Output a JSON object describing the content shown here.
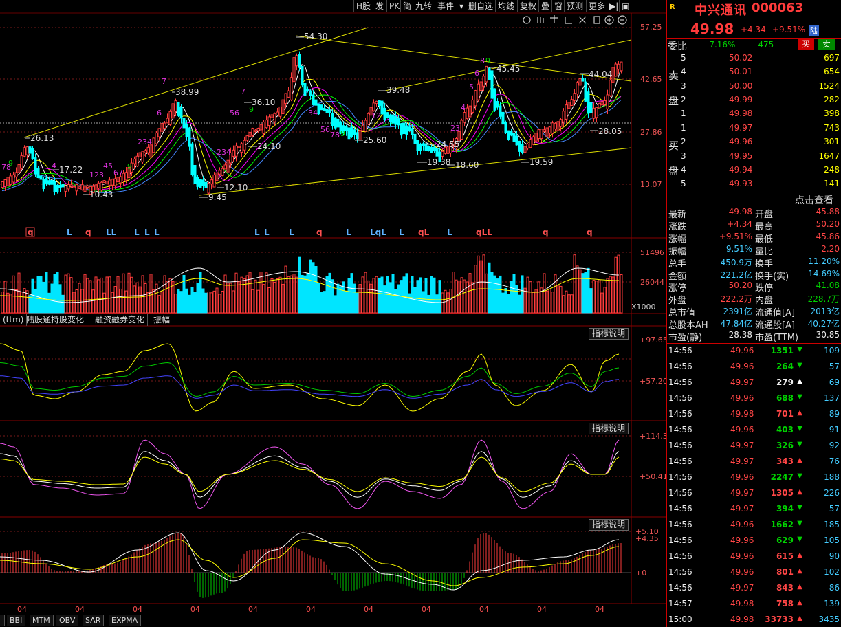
{
  "toolbar": {
    "items": [
      "H股",
      "发",
      "PK",
      "简",
      "九转",
      "事件",
      "▾",
      "删自选",
      "均线",
      "复权",
      "叠",
      "窗",
      "预测",
      "更多",
      "▶|",
      "▣"
    ]
  },
  "chart": {
    "price_axis": [
      "57.25",
      "42.65",
      "27.86",
      "13.07"
    ],
    "price_annotations": [
      "54.30",
      "45.45",
      "44.04",
      "38.99",
      "39.48",
      "36.10",
      "28.05",
      "26.13",
      "25.60",
      "24.55",
      "24.10",
      "19.38",
      "18.60",
      "19.59",
      "17.22",
      "12.10",
      "10.43",
      "9.45"
    ],
    "volume_axis": [
      "51496",
      "26044",
      "X1000"
    ],
    "osc1_axis": [
      "+97.65",
      "+57.20"
    ],
    "osc2_axis": [
      "+114.3",
      "+50.41"
    ],
    "macd_axis": [
      "+5.10",
      "+4.35",
      "+0"
    ],
    "date_labels": [
      "04",
      "04",
      "04",
      "04",
      "04",
      "04",
      "04",
      "04",
      "04",
      "04",
      "04"
    ],
    "signal_row": [
      "q",
      "L",
      "q",
      "LL",
      "L",
      "L",
      "L",
      "L",
      "L",
      "L",
      "q",
      "L",
      "LqL",
      "L",
      "qL",
      "L",
      "qLL",
      "q",
      "q"
    ],
    "mid_tabs": [
      "(ttm)",
      "陆股通持股变化",
      "融资融券变化",
      "振幅"
    ],
    "indicator_btn": "指标说明",
    "bottom_tabs": [
      "BBI",
      "MTM",
      "OBV",
      "SAR",
      "EXPMA"
    ]
  },
  "panel": {
    "r_icon": "R",
    "name": "中兴通讯",
    "code": "000063",
    "price": "49.98",
    "change": "+4.34",
    "change_pct": "+9.51%",
    "tag": "陆",
    "weibi_label": "委比",
    "weibi_pct": "-7.16%",
    "weibi_val": "-475",
    "buy_btn": "买",
    "sell_btn": "卖",
    "sell_side_label": [
      "卖",
      "盘"
    ],
    "buy_side_label": [
      "买",
      "盘"
    ],
    "sells": [
      {
        "lvl": "5",
        "price": "50.02",
        "vol": "697"
      },
      {
        "lvl": "4",
        "price": "50.01",
        "vol": "654"
      },
      {
        "lvl": "3",
        "price": "50.00",
        "vol": "1524"
      },
      {
        "lvl": "2",
        "price": "49.99",
        "vol": "282"
      },
      {
        "lvl": "1",
        "price": "49.98",
        "vol": "398"
      }
    ],
    "buys": [
      {
        "lvl": "1",
        "price": "49.97",
        "vol": "743"
      },
      {
        "lvl": "2",
        "price": "49.96",
        "vol": "301"
      },
      {
        "lvl": "3",
        "price": "49.95",
        "vol": "1647"
      },
      {
        "lvl": "4",
        "price": "49.94",
        "vol": "248"
      },
      {
        "lvl": "5",
        "price": "49.93",
        "vol": "141"
      }
    ],
    "click_view": "点击查看",
    "stats": [
      {
        "l1": "最新",
        "v1": "49.98",
        "c1": "red",
        "l2": "开盘",
        "v2": "45.88",
        "c2": "red"
      },
      {
        "l1": "涨跌",
        "v1": "+4.34",
        "c1": "red",
        "l2": "最高",
        "v2": "50.20",
        "c2": "red"
      },
      {
        "l1": "涨幅",
        "v1": "+9.51%",
        "c1": "red",
        "l2": "最低",
        "v2": "45.86",
        "c2": "red"
      },
      {
        "l1": "振幅",
        "v1": "9.51%",
        "c1": "cyan",
        "l2": "量比",
        "v2": "2.20",
        "c2": "red"
      },
      {
        "l1": "总手",
        "v1": "450.9万",
        "c1": "cyan",
        "l2": "换手",
        "v2": "11.20%",
        "c2": "cyan"
      },
      {
        "l1": "金额",
        "v1": "221.2亿",
        "c1": "cyan",
        "l2": "换手(实)",
        "v2": "14.69%",
        "c2": "cyan"
      },
      {
        "l1": "涨停",
        "v1": "50.20",
        "c1": "red",
        "l2": "跌停",
        "v2": "41.08",
        "c2": "green"
      },
      {
        "l1": "外盘",
        "v1": "222.2万",
        "c1": "red",
        "l2": "内盘",
        "v2": "228.7万",
        "c2": "green"
      },
      {
        "l1": "总市值",
        "v1": "2391亿",
        "c1": "cyan",
        "l2": "流通值[A]",
        "v2": "2013亿",
        "c2": "cyan"
      },
      {
        "l1": "总股本AH",
        "v1": "47.84亿",
        "c1": "cyan",
        "l2": "流通股[A]",
        "v2": "40.27亿",
        "c2": "cyan"
      },
      {
        "l1": "市盈(静)",
        "v1": "28.38",
        "c1": "white",
        "l2": "市盈(TTM)",
        "v2": "30.85",
        "c2": "white"
      }
    ],
    "ticks": [
      {
        "t": "14:56",
        "p": "49.96",
        "pc": "red",
        "v": "1351",
        "vc": "green",
        "arrow": "down",
        "n": "109"
      },
      {
        "t": "14:56",
        "p": "49.96",
        "pc": "red",
        "v": "264",
        "vc": "green",
        "arrow": "down",
        "n": "57"
      },
      {
        "t": "14:56",
        "p": "49.97",
        "pc": "red",
        "v": "279",
        "vc": "white",
        "arrow": "up-white",
        "n": "69"
      },
      {
        "t": "14:56",
        "p": "49.96",
        "pc": "red",
        "v": "688",
        "vc": "green",
        "arrow": "down",
        "n": "137"
      },
      {
        "t": "14:56",
        "p": "49.98",
        "pc": "red",
        "v": "701",
        "vc": "red",
        "arrow": "up",
        "n": "89"
      },
      {
        "t": "14:56",
        "p": "49.96",
        "pc": "red",
        "v": "403",
        "vc": "green",
        "arrow": "down",
        "n": "91"
      },
      {
        "t": "14:56",
        "p": "49.97",
        "pc": "red",
        "v": "326",
        "vc": "green",
        "arrow": "down",
        "n": "92"
      },
      {
        "t": "14:56",
        "p": "49.97",
        "pc": "red",
        "v": "343",
        "vc": "red",
        "arrow": "up",
        "n": "76"
      },
      {
        "t": "14:56",
        "p": "49.96",
        "pc": "red",
        "v": "2247",
        "vc": "green",
        "arrow": "down",
        "n": "188"
      },
      {
        "t": "14:56",
        "p": "49.97",
        "pc": "red",
        "v": "1305",
        "vc": "red",
        "arrow": "up",
        "n": "226"
      },
      {
        "t": "14:56",
        "p": "49.97",
        "pc": "red",
        "v": "394",
        "vc": "green",
        "arrow": "down",
        "n": "57"
      },
      {
        "t": "14:56",
        "p": "49.96",
        "pc": "red",
        "v": "1662",
        "vc": "green",
        "arrow": "down",
        "n": "185"
      },
      {
        "t": "14:56",
        "p": "49.96",
        "pc": "red",
        "v": "629",
        "vc": "green",
        "arrow": "down",
        "n": "105"
      },
      {
        "t": "14:56",
        "p": "49.96",
        "pc": "red",
        "v": "615",
        "vc": "red",
        "arrow": "up",
        "n": "90"
      },
      {
        "t": "14:56",
        "p": "49.96",
        "pc": "red",
        "v": "801",
        "vc": "red",
        "arrow": "up",
        "n": "102"
      },
      {
        "t": "14:56",
        "p": "49.97",
        "pc": "red",
        "v": "843",
        "vc": "red",
        "arrow": "up",
        "n": "86"
      },
      {
        "t": "14:57",
        "p": "49.98",
        "pc": "red",
        "v": "758",
        "vc": "red",
        "arrow": "up",
        "n": "139"
      },
      {
        "t": "15:00",
        "p": "49.98",
        "pc": "red",
        "v": "33733",
        "vc": "red",
        "arrow": "up",
        "n": "3435"
      }
    ]
  },
  "colors": {
    "up": "#ff3c3c",
    "down": "#00ffff",
    "accent": "#c00000",
    "brand": "#ff3333"
  }
}
